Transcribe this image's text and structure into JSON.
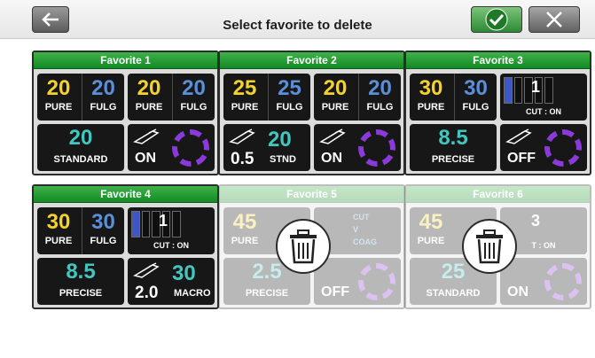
{
  "header": {
    "title": "Select favorite to delete",
    "back_icon": "arrow-left-icon",
    "confirm_icon": "checkmark-icon",
    "close_icon": "close-icon"
  },
  "favorites": [
    {
      "title": "Favorite 1",
      "top_left": {
        "left_value": "20",
        "left_label": "PURE",
        "right_value": "20",
        "right_label": "FULG"
      },
      "top_right": {
        "left_value": "20",
        "left_label": "PURE",
        "right_value": "20",
        "right_label": "FULG"
      },
      "bottom_left": {
        "value": "20",
        "label": "STANDARD"
      },
      "bottom_right": {
        "state": "ON"
      }
    },
    {
      "title": "Favorite 2",
      "top_left": {
        "left_value": "25",
        "left_label": "PURE",
        "right_value": "25",
        "right_label": "FULG"
      },
      "top_right": {
        "left_value": "20",
        "left_label": "PURE",
        "right_value": "20",
        "right_label": "FULG"
      },
      "bottom_left": {
        "small_value": "0.5",
        "value": "20",
        "label": "STND"
      },
      "bottom_right": {
        "state": "ON"
      }
    },
    {
      "title": "Favorite 3",
      "top_left": {
        "left_value": "30",
        "left_label": "PURE",
        "right_value": "30",
        "right_label": "FULG"
      },
      "top_right": {
        "cut_value": "1",
        "cut_label": "CUT : ON",
        "cut_level": 1
      },
      "bottom_left": {
        "value": "8.5",
        "label": "PRECISE"
      },
      "bottom_right": {
        "state": "OFF"
      }
    },
    {
      "title": "Favorite 4",
      "top_left": {
        "left_value": "30",
        "left_label": "PURE",
        "right_value": "30",
        "right_label": "FULG"
      },
      "top_right": {
        "cut_value": "1",
        "cut_label": "CUT : ON",
        "cut_level": 1
      },
      "bottom_left": {
        "value": "8.5",
        "label": "PRECISE"
      },
      "bottom_right": {
        "small_value": "2.0",
        "value": "30",
        "label": "MACRO"
      }
    },
    {
      "title": "Favorite 5",
      "top_left": {
        "left_value": "45",
        "left_label": "PURE"
      },
      "top_right": {
        "line1": "CUT",
        "line2": "V",
        "line3": "COAG"
      },
      "bottom_left": {
        "value": "2.5",
        "label": "PRECISE"
      },
      "bottom_right": {
        "state": "OFF"
      }
    },
    {
      "title": "Favorite 6",
      "top_left": {
        "left_value": "45",
        "left_label": "PURE"
      },
      "top_right": {
        "cut_value": "3",
        "cut_label": "T : ON"
      },
      "bottom_left": {
        "value": "25",
        "label": "STANDARD"
      },
      "bottom_right": {
        "state": "ON"
      }
    }
  ],
  "colors": {
    "header_green": "#2aa23a",
    "yellow_value": "#f4d22a",
    "blue_value": "#5b8fd8",
    "teal_value": "#42c7c0",
    "ring_purple": "#8a3ad8"
  }
}
